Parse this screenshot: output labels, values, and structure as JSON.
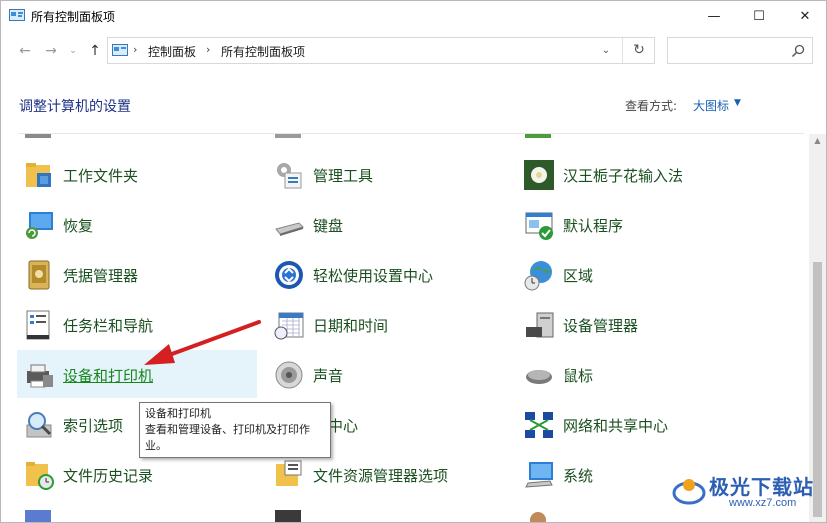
{
  "window": {
    "title": "所有控制面板项",
    "controls": {
      "minimize": "—",
      "maximize": "☐",
      "close": "✕"
    }
  },
  "nav": {
    "breadcrumb": [
      "控制面板",
      "所有控制面板项"
    ],
    "search_placeholder": ""
  },
  "header": {
    "title": "调整计算机的设置",
    "view_label": "查看方式:",
    "view_value": "大图标"
  },
  "items": [
    {
      "label": "工作文件夹",
      "icon": "work-folders-icon"
    },
    {
      "label": "管理工具",
      "icon": "admin-tools-icon"
    },
    {
      "label": "汉王栀子花输入法",
      "icon": "gardenia-ime-icon"
    },
    {
      "label": "恢复",
      "icon": "recovery-icon"
    },
    {
      "label": "键盘",
      "icon": "keyboard-icon"
    },
    {
      "label": "默认程序",
      "icon": "default-programs-icon"
    },
    {
      "label": "凭据管理器",
      "icon": "credential-manager-icon"
    },
    {
      "label": "轻松使用设置中心",
      "icon": "ease-of-access-icon"
    },
    {
      "label": "区域",
      "icon": "region-icon"
    },
    {
      "label": "任务栏和导航",
      "icon": "taskbar-icon"
    },
    {
      "label": "日期和时间",
      "icon": "date-time-icon"
    },
    {
      "label": "设备管理器",
      "icon": "device-manager-icon"
    },
    {
      "label": "设备和打印机",
      "icon": "devices-printers-icon"
    },
    {
      "label": "声音",
      "icon": "sound-icon"
    },
    {
      "label": "鼠标",
      "icon": "mouse-icon"
    },
    {
      "label": "索引选项",
      "icon": "indexing-icon"
    },
    {
      "label": "步中心",
      "icon": "sync-center-icon"
    },
    {
      "label": "网络和共享中心",
      "icon": "network-icon"
    },
    {
      "label": "文件历史记录",
      "icon": "file-history-icon"
    },
    {
      "label": "文件资源管理器选项",
      "icon": "explorer-options-icon"
    },
    {
      "label": "系统",
      "icon": "system-icon"
    }
  ],
  "tooltip": {
    "title": "设备和打印机",
    "body": "查看和管理设备、打印机及打印作业。"
  },
  "watermark": {
    "text": "极光下载站",
    "url": "www.xz7.com"
  }
}
